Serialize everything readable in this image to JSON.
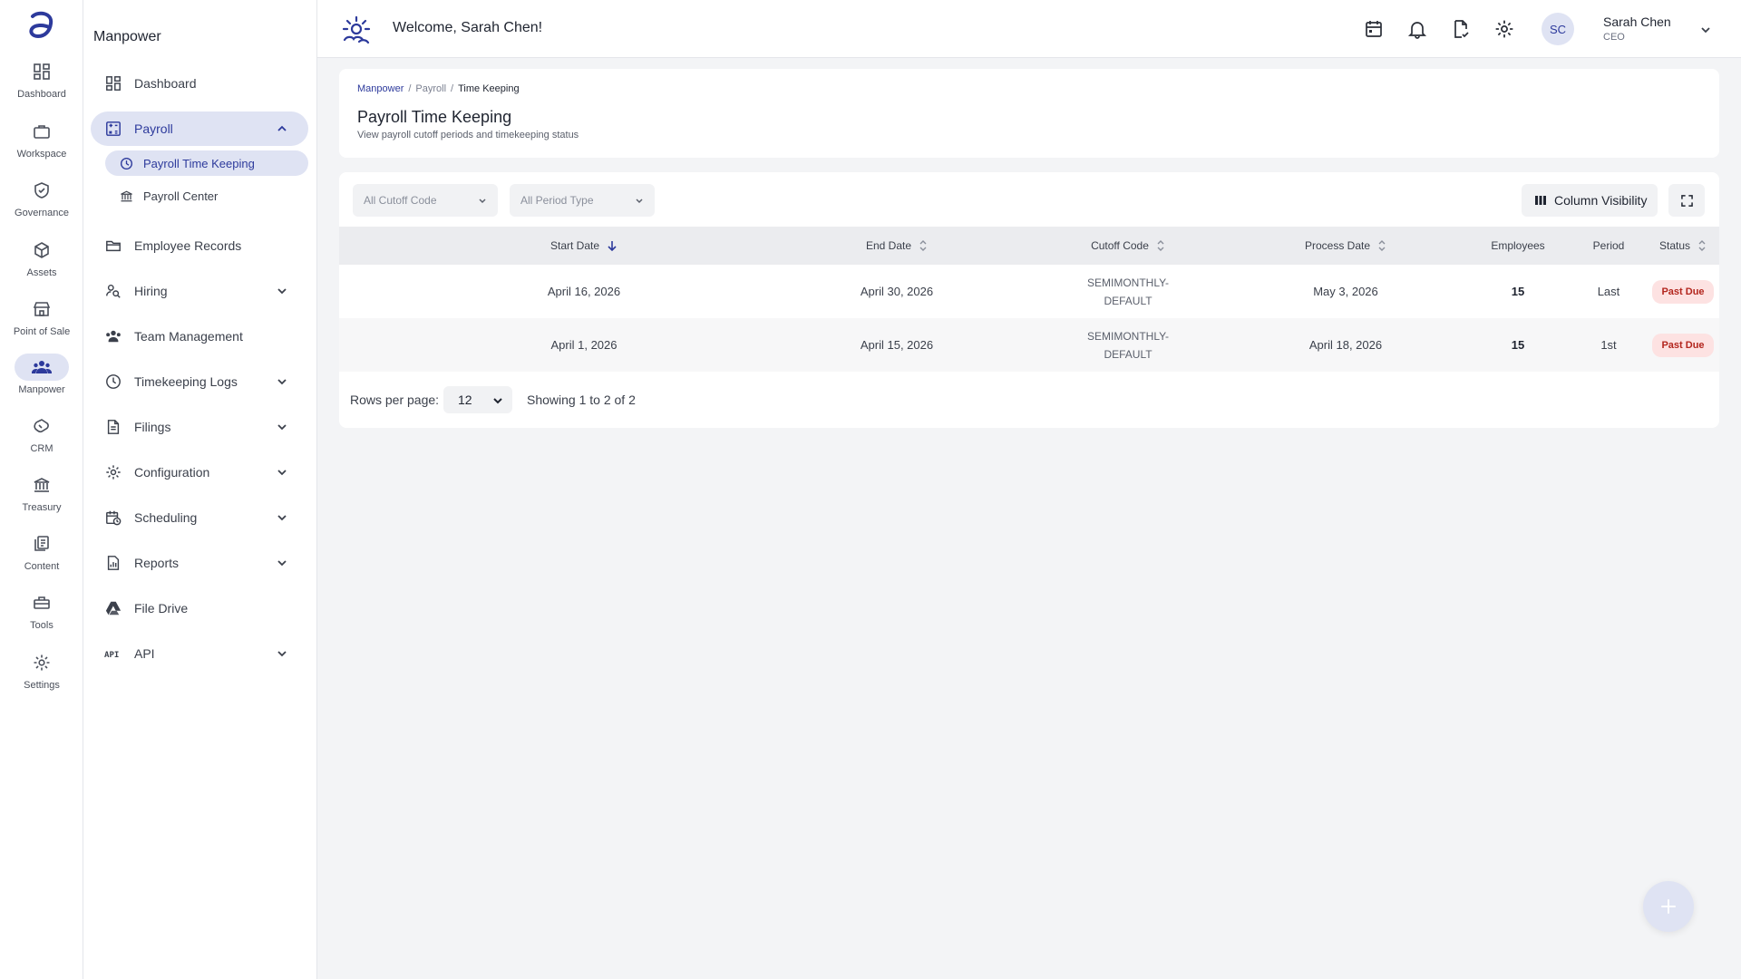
{
  "rail": {
    "items": [
      {
        "label": "Dashboard",
        "icon": "dashboard-icon"
      },
      {
        "label": "Workspace",
        "icon": "briefcase-icon"
      },
      {
        "label": "Governance",
        "icon": "shield-check-icon"
      },
      {
        "label": "Assets",
        "icon": "cube-icon"
      },
      {
        "label": "Point of Sale",
        "icon": "store-icon"
      },
      {
        "label": "Manpower",
        "icon": "people-icon"
      },
      {
        "label": "CRM",
        "icon": "handshake-icon"
      },
      {
        "label": "Treasury",
        "icon": "bank-icon"
      },
      {
        "label": "Content",
        "icon": "documents-icon"
      },
      {
        "label": "Tools",
        "icon": "toolbox-icon"
      },
      {
        "label": "Settings",
        "icon": "gear-icon"
      }
    ],
    "active": "Manpower"
  },
  "sidebar": {
    "title": "Manpower",
    "items": [
      {
        "label": "Dashboard",
        "icon": "dashboard-icon"
      },
      {
        "label": "Payroll",
        "icon": "calculator-icon"
      },
      {
        "label": "Payroll Time Keeping",
        "icon": "clock-icon"
      },
      {
        "label": "Payroll Center",
        "icon": "bank-icon"
      },
      {
        "label": "Employee Records",
        "icon": "folder-open-icon"
      },
      {
        "label": "Hiring",
        "icon": "person-search-icon"
      },
      {
        "label": "Team Management",
        "icon": "team-icon"
      },
      {
        "label": "Timekeeping Logs",
        "icon": "clock-icon"
      },
      {
        "label": "Filings",
        "icon": "document-icon"
      },
      {
        "label": "Configuration",
        "icon": "gear-icon"
      },
      {
        "label": "Scheduling",
        "icon": "calendar-clock-icon"
      },
      {
        "label": "Reports",
        "icon": "report-icon"
      },
      {
        "label": "File Drive",
        "icon": "drive-icon"
      },
      {
        "label": "API",
        "icon": "api-icon"
      }
    ]
  },
  "header": {
    "welcome": "Welcome, Sarah Chen!",
    "user": {
      "initials": "SC",
      "name": "Sarah Chen",
      "role": "CEO"
    }
  },
  "page": {
    "breadcrumb": [
      "Manpower",
      "Payroll",
      "Time Keeping"
    ],
    "separator": "/",
    "title": "Payroll Time Keeping",
    "subtitle": "View payroll cutoff periods and timekeeping status"
  },
  "filters": {
    "cutoff_code": "All Cutoff Code",
    "period_type": "All Period Type",
    "column_visibility": "Column Visibility"
  },
  "table": {
    "headers": [
      "Start Date",
      "End Date",
      "Cutoff Code",
      "Process Date",
      "Employees",
      "Period",
      "Status"
    ],
    "sorted_column": "Start Date",
    "sort_direction": "desc",
    "rows": [
      {
        "start": "April 16, 2026",
        "end": "April 30, 2026",
        "code_line1": "SEMIMONTHLY-",
        "code_line2": "DEFAULT",
        "process": "May 3, 2026",
        "employees": "15",
        "period": "Last",
        "status": "Past Due"
      },
      {
        "start": "April 1, 2026",
        "end": "April 15, 2026",
        "code_line1": "SEMIMONTHLY-",
        "code_line2": "DEFAULT",
        "process": "April 18, 2026",
        "employees": "15",
        "period": "1st",
        "status": "Past Due"
      }
    ]
  },
  "pagination": {
    "rows_per_page_label": "Rows per page:",
    "rows_per_page": "12",
    "showing": "Showing 1 to 2 of 2"
  },
  "colors": {
    "accent": "#2d3a9c",
    "active_bg": "#dfe3f3",
    "badge_bg": "#fde2e2",
    "badge_text": "#b3261e"
  }
}
